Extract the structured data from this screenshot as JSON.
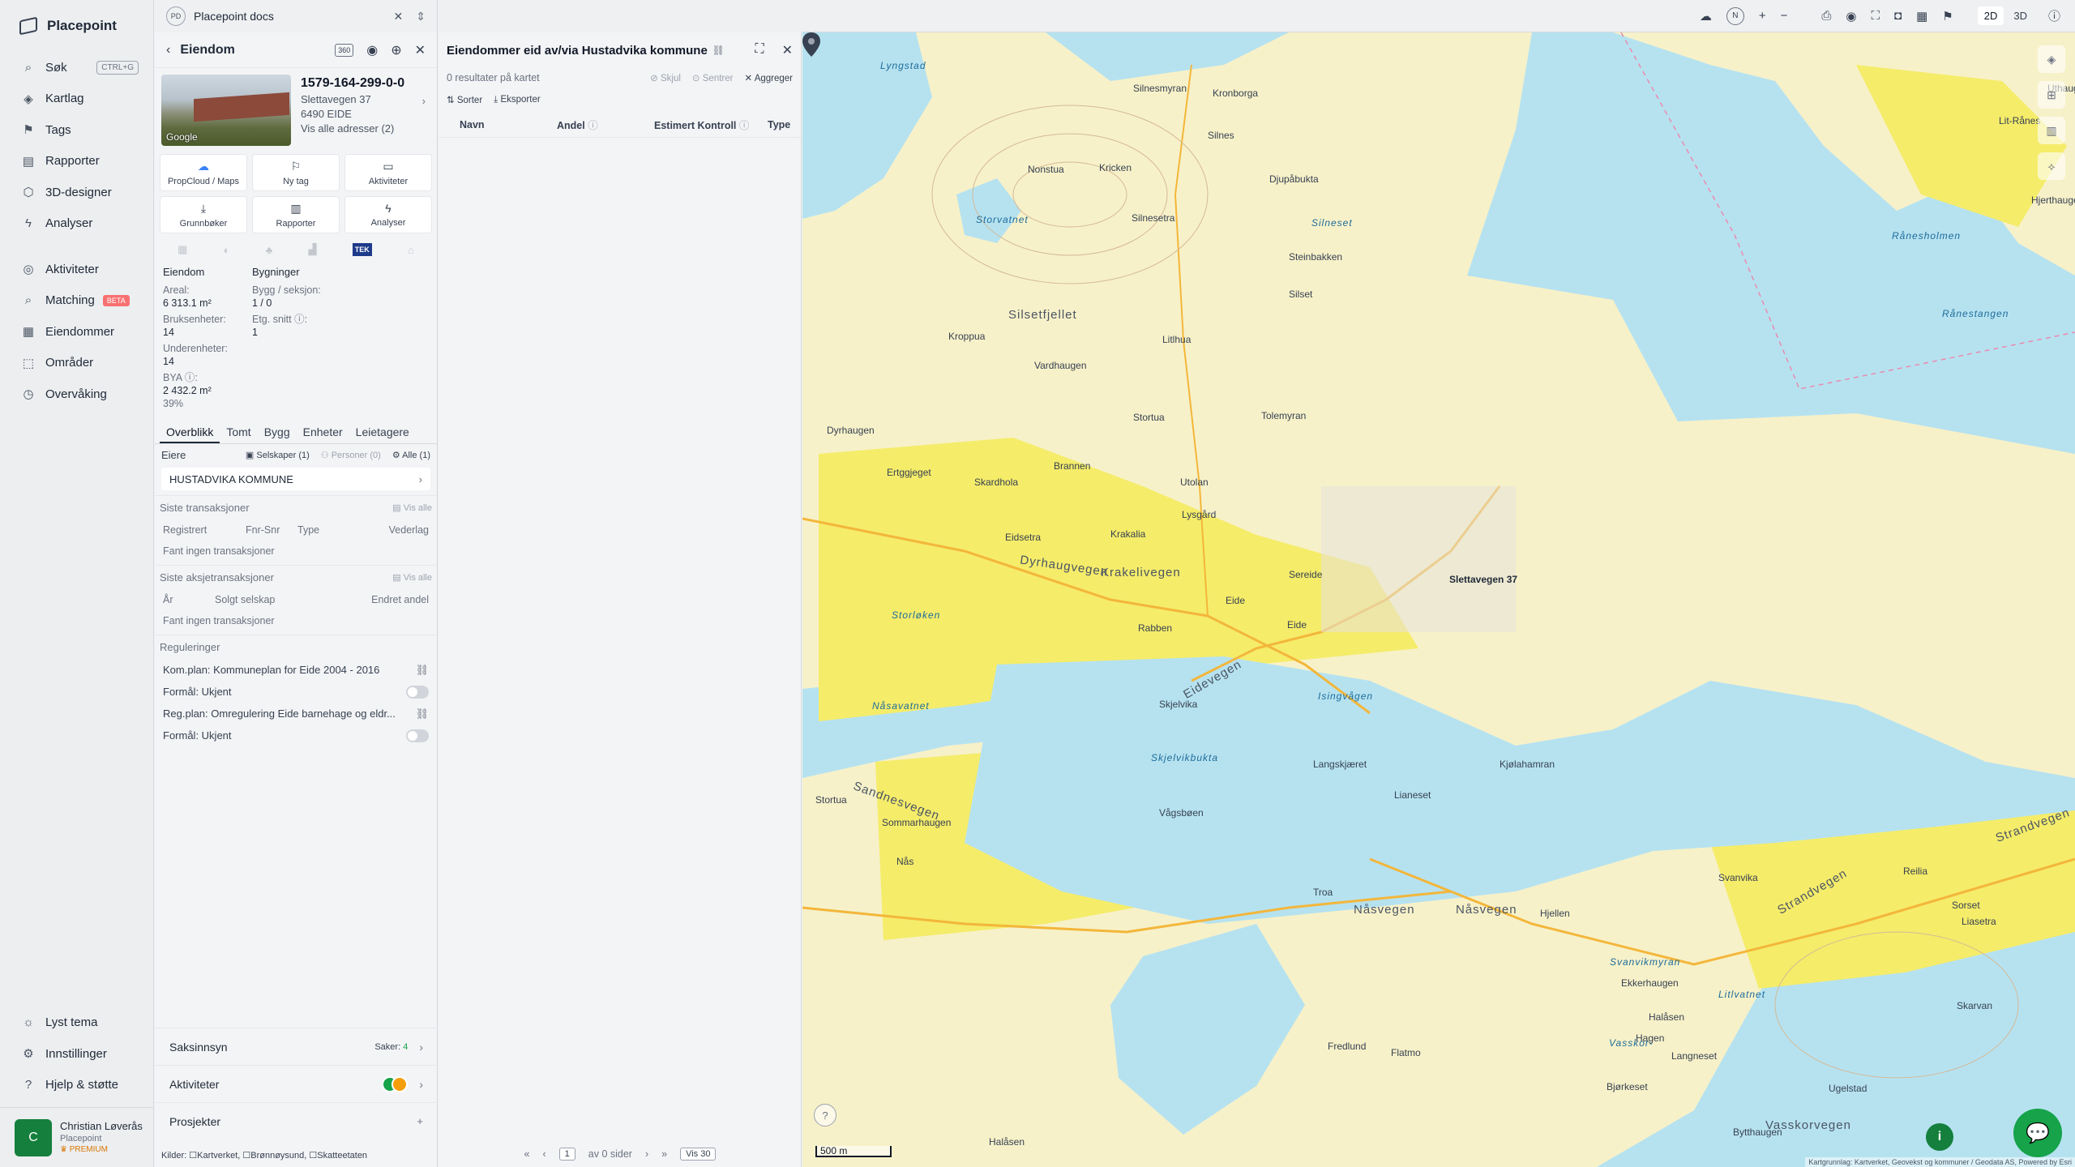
{
  "app": {
    "name": "Placepoint"
  },
  "nav": {
    "items": [
      {
        "icon": "search-icon",
        "glyph": "⌕",
        "label": "Søk",
        "shortcut": "CTRL+G"
      },
      {
        "icon": "layers-icon",
        "glyph": "◈",
        "label": "Kartlag"
      },
      {
        "icon": "bookmark-icon",
        "glyph": "⚑",
        "label": "Tags"
      },
      {
        "icon": "chart-icon",
        "glyph": "▤",
        "label": "Rapporter"
      },
      {
        "icon": "cube-icon",
        "glyph": "⬡",
        "label": "3D-designer"
      },
      {
        "icon": "bolt-icon",
        "glyph": "ϟ",
        "label": "Analyser"
      }
    ],
    "items2": [
      {
        "icon": "activity-icon",
        "glyph": "◎",
        "label": "Aktiviteter"
      },
      {
        "icon": "match-icon",
        "glyph": "⌕",
        "label": "Matching",
        "badge": "BETA"
      },
      {
        "icon": "building-icon",
        "glyph": "▦",
        "label": "Eiendommer"
      },
      {
        "icon": "area-icon",
        "glyph": "⬚",
        "label": "Områder"
      },
      {
        "icon": "monitor-icon",
        "glyph": "◷",
        "label": "Overvåking"
      }
    ],
    "bottom": [
      {
        "icon": "sun-icon",
        "glyph": "☼",
        "label": "Lyst tema"
      },
      {
        "icon": "gear-icon",
        "glyph": "⚙",
        "label": "Innstillinger"
      },
      {
        "icon": "help-icon",
        "glyph": "?",
        "label": "Hjelp & støtte"
      }
    ],
    "user": {
      "initial": "C",
      "name": "Christian Løverås",
      "org": "Placepoint",
      "plan": "PREMIUM"
    }
  },
  "workspace": {
    "badge": "PD",
    "name": "Placepoint docs"
  },
  "property": {
    "panel_title": "Eiendom",
    "matrikkel": "1579-164-299-0-0",
    "street": "Slettavegen 37",
    "postal": "6490 EIDE",
    "all_addresses": "Vis alle adresser (2)",
    "photo_label": "Google",
    "tiles": [
      {
        "icon": "cloud-icon",
        "glyph": "☁",
        "label": "PropCloud / Maps",
        "blue": true
      },
      {
        "icon": "bookmark-icon",
        "glyph": "⚐",
        "label": "Ny tag"
      },
      {
        "icon": "chat-icon",
        "glyph": "▭",
        "label": "Aktiviteter"
      },
      {
        "icon": "download-icon",
        "glyph": "⤓",
        "label": "Grunnbøker"
      },
      {
        "icon": "chart-icon",
        "glyph": "▥",
        "label": "Rapporter"
      },
      {
        "icon": "bolt-icon",
        "glyph": "ϟ",
        "label": "Analyser"
      }
    ],
    "tek_label": "TEK",
    "stats": {
      "col1_header": "Eiendom",
      "col2_header": "Bygninger",
      "areal_label": "Areal:",
      "areal_value": "6 313.1 m²",
      "bygg_label": "Bygg / seksjon:",
      "bygg_value": "1 / 0",
      "bruks_label": "Bruksenheter:",
      "bruks_value": "14",
      "etg_label": "Etg. snitt ⓘ:",
      "etg_value": "1",
      "under_label": "Underenheter:",
      "under_value": "14",
      "bya_label": "BYA ⓘ:",
      "bya_value": "2 432.2 m²",
      "bya_pct": "39%"
    },
    "tabs": [
      "Overblikk",
      "Tomt",
      "Bygg",
      "Enheter",
      "Leietagere"
    ],
    "owners": {
      "label": "Eiere",
      "companies": "Selskaper (1)",
      "persons": "Personer (0)",
      "all": "Alle (1)",
      "owner_name": "HUSTADVIKA KOMMUNE"
    },
    "transactions": {
      "title": "Siste transaksjoner",
      "show_all": "Vis alle",
      "cols": [
        "Registrert",
        "Fnr-Snr",
        "Type",
        "Vederlag"
      ],
      "empty": "Fant ingen transaksjoner"
    },
    "stock_tx": {
      "title": "Siste aksjetransaksjoner",
      "show_all": "Vis alle",
      "cols": [
        "År",
        "Solgt selskap",
        "Endret andel"
      ],
      "empty": "Fant ingen transaksjoner"
    },
    "regulations": {
      "title": "Reguleringer",
      "items": [
        "Kom.plan: Kommuneplan for Eide 2004 - 2016",
        "Formål: Ukjent",
        "Reg.plan: Omregulering Eide barnehage og eldr...",
        "Formål: Ukjent"
      ]
    },
    "accordion": {
      "case": "Saksinnsyn",
      "case_count_label": "Saker:",
      "case_count": "4",
      "activities": "Aktiviteter",
      "projects": "Prosjekter"
    },
    "sources": {
      "label": "Kilder:",
      "items": [
        "Kartverket,",
        "Brønnøysund,",
        "Skatteetaten"
      ]
    }
  },
  "results": {
    "title": "Eiendommer eid av/via Hustadvika kommune",
    "count": "0 resultater på kartet",
    "hide": "Skjul",
    "center": "Sentrer",
    "aggregate": "Aggreger",
    "sort": "Sorter",
    "export": "Eksporter",
    "columns": [
      "Navn",
      "Andel",
      "Estimert Kontroll",
      "Type"
    ],
    "page_value": "1",
    "page_of": "av 0 sider",
    "per_page": "Vis 30"
  },
  "toolbar": {
    "north": "N",
    "mode_2d": "2D",
    "mode_3d": "3D"
  },
  "map": {
    "scale": "500 m",
    "attribution": "Kartgrunnlag: Kartverket, Geovekst og kommuner / Geodata AS, Powered by Esri",
    "colors": {
      "water": "#b6e2f0",
      "forest": "#f7f1c9",
      "farmland": "#f5ec6a",
      "road": "#f3b63a"
    },
    "labels": {
      "lyngstad": "Lyngstad",
      "kronborga": "Kronborga",
      "silnesmyran": "Silnesmyran",
      "silnes": "Silnes",
      "djupabukta": "Djupåbukta",
      "nonstua": "Nonstua",
      "kricken": "Kricken",
      "silnesetra": "Silnesetra",
      "silneset": "Silneset",
      "storvatnet": "Storvatnet",
      "steinbakken": "Steinbakken",
      "silsetfjellet": "Silsetfjellet",
      "kroppua": "Kroppua",
      "vardhaugen": "Vardhaugen",
      "litlhua": "Litlhua",
      "silset": "Silset",
      "tolemyran": "Tolemyran",
      "stortua": "Stortua",
      "dyrhaugen": "Dyrhaugen",
      "brannen": "Brannen",
      "utolan": "Utolan",
      "lysgard": "Lysgård",
      "ertggjeget": "Ertggjeget",
      "skardhola": "Skardhola",
      "krakalia": "Krakalia",
      "eidsetra": "Eidsetra",
      "dyrhaugvegen": "Dyrhaugvegen",
      "krakelivegen": "Krakelivegen",
      "storloken": "Storløken",
      "rabben": "Rabben",
      "eide": "Eide",
      "sereide": "Sereide",
      "eidevegen": "Eidevegen",
      "nasavatnet": "Nåsavatnet",
      "isingvagen": "Isingvågen",
      "skjelvika": "Skjelvika",
      "skjelvikbukta": "Skjelvikbukta",
      "langskjaeret": "Langskjæret",
      "kjolahamran": "Kjølahamran",
      "sandnesvegen": "Sandnesvegen",
      "sommarhaugen": "Sommarhaugen",
      "vagsboen": "Vågsbøen",
      "lianeset": "Lianeset",
      "strandvegen": "Strandvegen",
      "stortua2": "Stortua",
      "nas": "Nås",
      "svanvika": "Svanvika",
      "reilia": "Reilia",
      "sorset": "Sorset",
      "troa": "Troa",
      "nasvegen": "Nåsvegen",
      "hjellen": "Hjellen",
      "liasetra": "Liasetra",
      "svanvikmyran": "Svanvikmyran",
      "litlvatnet": "Litlvatnet",
      "ekkerhaugen": "Ekkerhaugen",
      "halasen": "Halåsen",
      "hagen": "Hagen",
      "skarvan": "Skarvan",
      "fredlund": "Fredlund",
      "flatmo": "Flatmo",
      "vasskor": "Vasskor-",
      "langneset": "Langneset",
      "bjorkeset": "Bjørkeset",
      "bytthaugen": "Bytthaugen",
      "ugelstad": "Ugelstad",
      "uthaug": "Uthaug",
      "litranes": "Lit-Rånes",
      "hjerthaugen": "Hjerthaugen",
      "ranesholmen": "Rånesholmen",
      "ranestangen": "Rånestangen",
      "vasskorvegen": "Vasskorvegen",
      "halasen2": "Halåsen",
      "marker": "Slettavegen 37"
    }
  }
}
